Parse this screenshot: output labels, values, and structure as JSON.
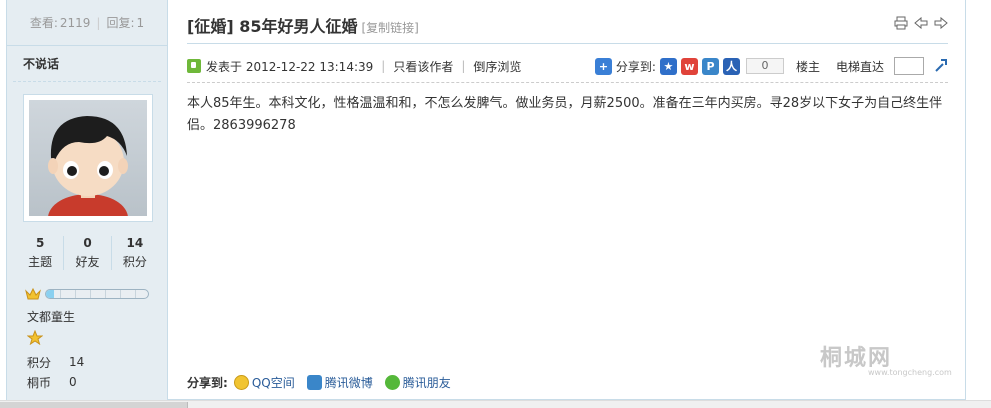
{
  "stats": {
    "views_label": "查看:",
    "views": "2119",
    "replies_label": "回复:",
    "replies": "1"
  },
  "author": {
    "name": "不说话"
  },
  "user_stats": [
    {
      "value": "5",
      "label": "主题"
    },
    {
      "value": "0",
      "label": "好友"
    },
    {
      "value": "14",
      "label": "积分"
    }
  ],
  "level": {
    "progress": 0.08,
    "rank": "文都童生"
  },
  "credits": [
    {
      "key": "积分",
      "value": "14"
    },
    {
      "key": "桐币",
      "value": "0"
    }
  ],
  "thread": {
    "title": "[征婚] 85年好男人征婚",
    "copy_link": "[复制链接]"
  },
  "meta": {
    "posted": "发表于 2012-12-22 13:14:39",
    "only_author": "只看该作者",
    "reverse": "倒序浏览",
    "share_to": "分享到:",
    "share_count": "0",
    "floor": "楼主",
    "jump": "电梯直达"
  },
  "content": "本人85年生。本科文化，性格温温和和，不怎么发脾气。做业务员，月薪2500。准备在三年内买房。寻28岁以下女子为自己终生伴侣。2863996278",
  "share_bottom": {
    "label": "分享到:",
    "items": [
      "QQ空间",
      "腾讯微博",
      "腾讯朋友"
    ]
  },
  "watermark": {
    "text": "桐城网",
    "sub": "www.tongcheng.com"
  },
  "colors": {
    "accent": "#2a5c99",
    "sidebar_bg": "#e5edf2",
    "border": "#c8dce8"
  }
}
